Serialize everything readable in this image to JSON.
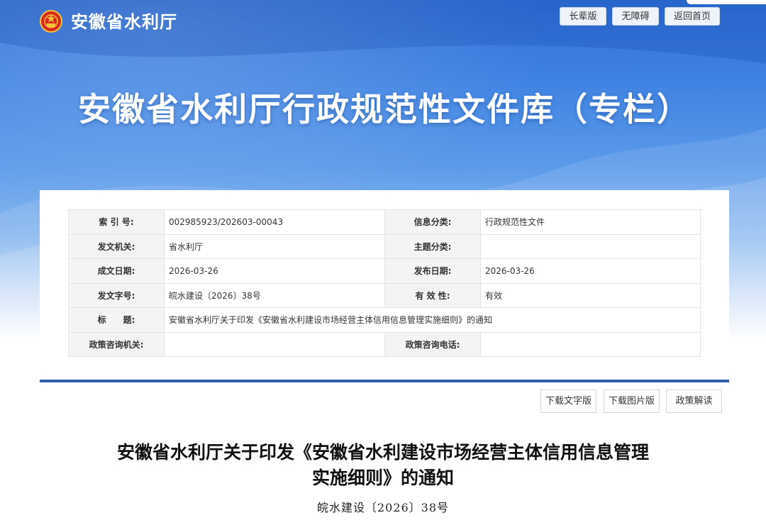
{
  "header": {
    "site_name": "安徽省水利厅",
    "buttons": [
      "长辈版",
      "无障碍",
      "返回首页"
    ]
  },
  "banner": {
    "title": "安徽省水利厅行政规范性文件库（专栏）"
  },
  "info_table": {
    "rows": [
      {
        "l1": "索 引 号:",
        "v1": "002985923/202603-00043",
        "l2": "信息分类:",
        "v2": "行政规范性文件"
      },
      {
        "l1": "发文机关:",
        "v1": "省水利厅",
        "l2": "主题分类:",
        "v2": ""
      },
      {
        "l1": "成文日期:",
        "v1": "2026-03-26",
        "l2": "发布日期:",
        "v2": "2026-03-26"
      },
      {
        "l1": "发文字号:",
        "v1": "皖水建设〔2026〕38号",
        "l2": "有 效 性:",
        "v2": "有效"
      },
      {
        "l1": "标　　题:",
        "v1": "安徽省水利厅关于印发《安徽省水利建设市场经营主体信用信息管理实施细则》的通知"
      },
      {
        "l1": "政策咨询机关:",
        "v1": "",
        "l2": "政策咨询电话:",
        "v2": ""
      }
    ]
  },
  "actions": [
    "下载文字版",
    "下载图片版",
    "政策解读"
  ],
  "document": {
    "title_line1": "安徽省水利厅关于印发《安徽省水利建设市场经营主体信用信息管理",
    "title_line2": "实施细则》的通知",
    "number": "皖水建设〔2026〕38号"
  },
  "colors": {
    "banner_blue": "#3f83e3",
    "divider_blue": "#2f5fa8"
  },
  "icons": {
    "emblem": "national-emblem-icon"
  }
}
